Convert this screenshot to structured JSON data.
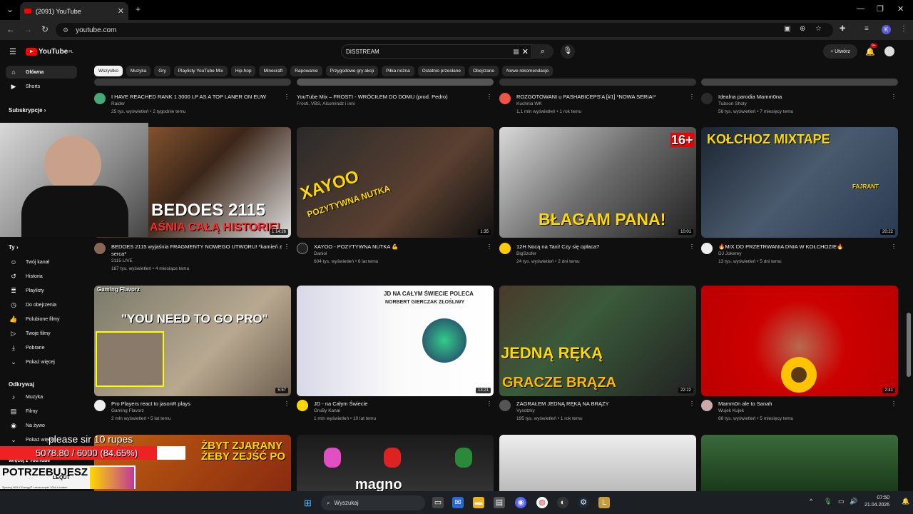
{
  "browser": {
    "tab_title": "(2091) YouTube",
    "url": "youtube.com"
  },
  "header": {
    "logo_text": "YouTube",
    "logo_region": "PL",
    "search_value": "DISSTREAM",
    "create_label": "+ Utwórz",
    "bell_badge": "9+"
  },
  "sidebar": {
    "main": [
      {
        "label": "Główna",
        "icon": "home-icon"
      },
      {
        "label": "Shorts",
        "icon": "shorts-icon"
      }
    ],
    "subs_heading": "Subskrypcje  ›",
    "you_heading": "Ty  ›",
    "you_items": [
      {
        "label": "Twój kanał",
        "icon": "channel-icon"
      },
      {
        "label": "Historia",
        "icon": "history-icon"
      },
      {
        "label": "Playlisty",
        "icon": "playlist-icon"
      },
      {
        "label": "Do obejrzenia",
        "icon": "clock-icon"
      },
      {
        "label": "Polubione filmy",
        "icon": "like-icon"
      },
      {
        "label": "Twoje filmy",
        "icon": "video-icon"
      },
      {
        "label": "Pobrane",
        "icon": "download-icon"
      },
      {
        "label": "Pokaż więcej",
        "icon": "chevron-down-icon"
      }
    ],
    "explore_heading": "Odkrywaj",
    "explore_items": [
      {
        "label": "Muzyka",
        "icon": "music-icon"
      },
      {
        "label": "Filmy",
        "icon": "film-icon"
      },
      {
        "label": "Na żywo",
        "icon": "live-icon"
      },
      {
        "label": "Pokaż więcej",
        "icon": "chevron-down-icon"
      }
    ],
    "more_heading": "Więcej z YouTube"
  },
  "chips": [
    "Wszystko",
    "Muzyka",
    "Gry",
    "Playlisty YouTube Mix",
    "Hip-hop",
    "Minecraft",
    "Rapowanie",
    "Przygodowe gry akcji",
    "Piłka nożna",
    "Ostatnio przesłane",
    "Obejrzane",
    "Nowe rekomendacje"
  ],
  "videos_row0": [
    {
      "title": "I HAVE REACHED RANK 1 3000 LP AS A TOP LANER ON EUW",
      "channel": "Raider",
      "stats": "25 tys. wyświetleń • 2 tygodnie temu"
    },
    {
      "title": "YouTube Mix – FROSTI - WRÓCIŁEM DO DOMU (prod. Pedro)",
      "channel": "Frosti, VBS, Alcomindz i inni",
      "stats": ""
    },
    {
      "title": "ROZGOTOWANI u PASHABICEPS'A [#1] *NOWA SERIA!*",
      "channel": "Kuchnia WK",
      "stats": "1,1 mln wyświetleń • 1 rok temu"
    },
    {
      "title": "Idealna parodia Mamm0na",
      "channel": "Tubson Shoty",
      "stats": "56 tys. wyświetleń • 7 miesięcy temu"
    }
  ],
  "videos_row1": [
    {
      "title": "BEDOES 2115 wyjaśnia FRAGMENTY NOWEGO UTWORU! *kamień z serca*",
      "channel": "2115 LIVE",
      "stats": "187 tys. wyświetleń • 4 miesiące temu",
      "duration": "1:14:26",
      "thumb_text": "BEDOES 2115",
      "thumb_sub": "AŚNIA CAŁĄ HISTORIĘ!"
    },
    {
      "title": "XAYOO - POZYTYWNA NUTKA 💪",
      "channel": "Daniol",
      "stats": "604 tys. wyświetleń • 6 lat temu",
      "duration": "1:35",
      "thumb_text": "XAYOO",
      "thumb_sub": "POZYTYWNA NUTKA"
    },
    {
      "title": "12H Nocą na Taxi! Czy się opłaca?",
      "channel": "BigSzofer",
      "stats": "24 tys. wyświetleń • 2 dni temu",
      "duration": "10:01",
      "thumb_text": "BŁAGAM PANA!",
      "thumb_sub": "16+"
    },
    {
      "title": "🔥MIX DO PRZETRWANIA DNIA W KOŁCHOZIE🔥",
      "channel": "DJ Jokerey",
      "stats": "13 tys. wyświetleń • 5 dni temu",
      "duration": "20:22",
      "thumb_text": "KOŁCHOZ MIXTAPE",
      "thumb_sub": "FAJRANT"
    }
  ],
  "videos_row2": [
    {
      "title": "Pro Players react to jasonR plays",
      "channel": "Gaming Flavorz",
      "stats": "2 mln wyświetleń • 5 lat temu",
      "duration": "5:57",
      "thumb_text": "\"YOU NEED TO GO PRO\"",
      "thumb_sub": "Gaming Flavorz"
    },
    {
      "title": "JD - na Całym Świecie",
      "channel": "GruBy Kanał",
      "stats": "1 mln wyświetleń • 10 lat temu",
      "duration": "13:21",
      "thumb_text": "JD NA CAŁYM ŚWIECIE POLECA",
      "thumb_sub": "NORBERT GIERCZAK ZŁOŚLIWY"
    },
    {
      "title": "ZAGRAŁEM JEDNĄ RĘKĄ NA BRĄZY",
      "channel": "Vysotzky",
      "stats": "195 tys. wyświetleń • 1 rok temu",
      "duration": "22:22",
      "thumb_text": "JEDNĄ RĘKĄ",
      "thumb_sub": "GRACZE BRĄZA"
    },
    {
      "title": "Mamm0n ale to Sanah",
      "channel": "Wujek Kujek",
      "stats": "68 tys. wyświetleń • 5 miesięcy temu",
      "duration": "2:41",
      "thumb_text": "",
      "thumb_sub": ""
    }
  ],
  "videos_row3": [
    {
      "thumb_text": "ŻBYT ZJARANY ŻEBY ZEJŚĆ PO"
    },
    {
      "thumb_text": "magno"
    },
    {
      "thumb_text": ""
    },
    {
      "thumb_text": ""
    }
  ],
  "stream_overlay": {
    "message": "please sir 10 rupes",
    "progress_label": "5078.80 / 6000 (84.65%)",
    "progress_fraction": 0.8465,
    "ad_headline": "POTRZEBUJESZ KOPA?",
    "ad_brand": "LEQUT",
    "ad_small": "Sprobuj HOLY Energy® i zaoszczędź 10% z kodem"
  },
  "taskbar": {
    "search_label": "Wyszukaj",
    "time": "07:50",
    "date": "21.04.2026"
  }
}
